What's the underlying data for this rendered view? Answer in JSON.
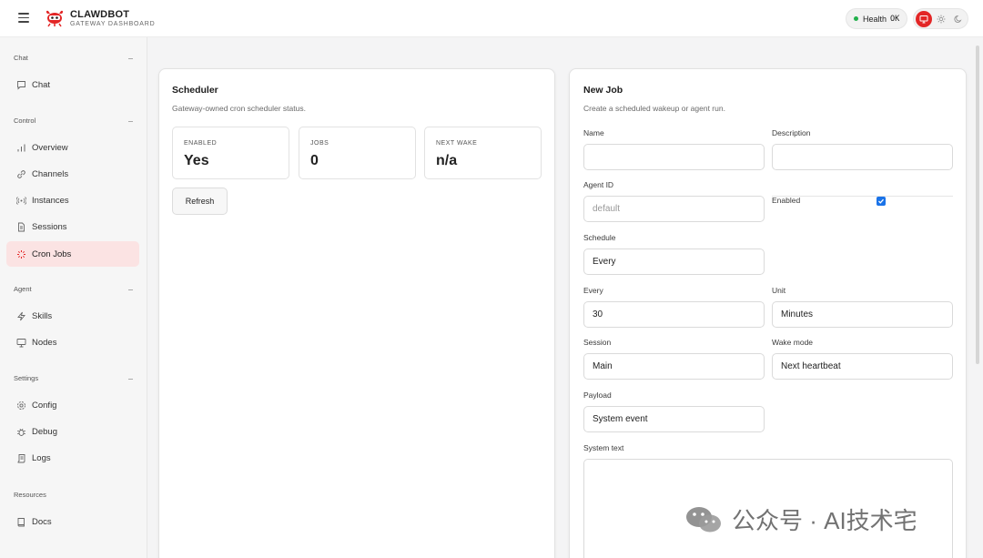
{
  "app": {
    "title": "CLAWDBOT",
    "subtitle": "GATEWAY DASHBOARD"
  },
  "health": {
    "label": "Health",
    "status": "OK",
    "dot_color": "#22b04b"
  },
  "theme": {
    "active": "monitor",
    "options": [
      "monitor-icon",
      "sun-icon",
      "moon-icon"
    ],
    "accent": "#e32626"
  },
  "sidebar": {
    "groups": [
      {
        "label": "Chat",
        "items": [
          {
            "label": "Chat",
            "icon": "chat-bubble-icon"
          }
        ]
      },
      {
        "label": "Control",
        "items": [
          {
            "label": "Overview",
            "icon": "bar-chart-icon"
          },
          {
            "label": "Channels",
            "icon": "link-icon"
          },
          {
            "label": "Instances",
            "icon": "radio-icon"
          },
          {
            "label": "Sessions",
            "icon": "document-icon"
          },
          {
            "label": "Cron Jobs",
            "icon": "loader-icon",
            "active": true
          }
        ]
      },
      {
        "label": "Agent",
        "items": [
          {
            "label": "Skills",
            "icon": "bolt-icon"
          },
          {
            "label": "Nodes",
            "icon": "monitor-icon"
          }
        ]
      },
      {
        "label": "Settings",
        "items": [
          {
            "label": "Config",
            "icon": "gear-icon"
          },
          {
            "label": "Debug",
            "icon": "bug-icon"
          },
          {
            "label": "Logs",
            "icon": "scroll-icon"
          }
        ]
      },
      {
        "label": "Resources",
        "items": [
          {
            "label": "Docs",
            "icon": "book-icon"
          }
        ]
      }
    ]
  },
  "scheduler": {
    "title": "Scheduler",
    "subtitle": "Gateway-owned cron scheduler status.",
    "stats": [
      {
        "label": "ENABLED",
        "value": "Yes"
      },
      {
        "label": "JOBS",
        "value": "0"
      },
      {
        "label": "NEXT WAKE",
        "value": "n/a"
      }
    ],
    "refresh_label": "Refresh"
  },
  "new_job": {
    "title": "New Job",
    "subtitle": "Create a scheduled wakeup or agent run.",
    "name_label": "Name",
    "name_value": "",
    "description_label": "Description",
    "description_value": "",
    "agent_id_label": "Agent ID",
    "agent_id_placeholder": "default",
    "enabled_label": "Enabled",
    "enabled_checked": true,
    "schedule_label": "Schedule",
    "schedule_value": "Every",
    "every_label": "Every",
    "every_value": "30",
    "unit_label": "Unit",
    "unit_value": "Minutes",
    "session_label": "Session",
    "session_value": "Main",
    "wake_mode_label": "Wake mode",
    "wake_mode_value": "Next heartbeat",
    "payload_label": "Payload",
    "payload_value": "System event",
    "system_text_label": "System text",
    "system_text_value": ""
  },
  "watermark": {
    "text": "公众号 · AI技术宅"
  }
}
